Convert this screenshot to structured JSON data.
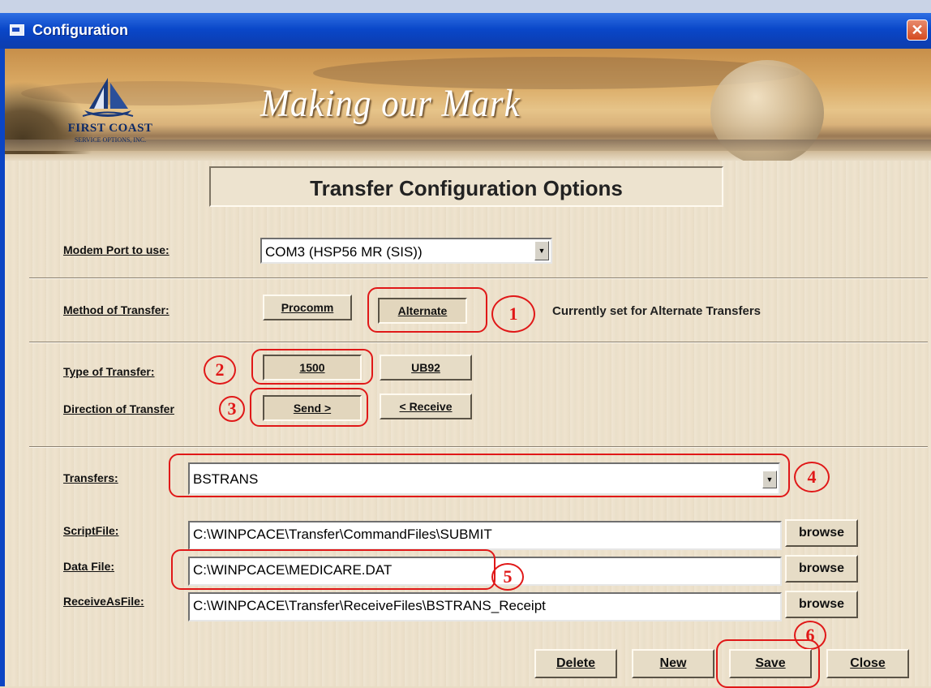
{
  "window": {
    "title": "Configuration",
    "close_glyph": "✕"
  },
  "banner": {
    "logo_name": "FIRST COAST",
    "logo_sub": "SERVICE OPTIONS, INC.",
    "tagline": "Making our Mark"
  },
  "heading": "Transfer Configuration Options",
  "modem": {
    "label": "Modem Port to use:",
    "value": "COM3 (HSP56 MR (SIS))"
  },
  "method": {
    "label": "Method of Transfer:",
    "procomm": "Procomm",
    "alternate": "Alternate",
    "status": "Currently set for Alternate Transfers"
  },
  "type": {
    "label": "Type of Transfer:",
    "opt1500": "1500",
    "optUB92": "UB92"
  },
  "direction": {
    "label": "Direction of Transfer",
    "send": "Send >",
    "receive": "< Receive"
  },
  "transfers": {
    "label": "Transfers:",
    "value": "BSTRANS"
  },
  "files": {
    "script_label": "ScriptFile:",
    "script_value": "C:\\WINPCACE\\Transfer\\CommandFiles\\SUBMIT",
    "data_label": "Data File:",
    "data_value": "C:\\WINPCACE\\MEDICARE.DAT",
    "receive_label": "ReceiveAsFile:",
    "receive_value": "C:\\WINPCACE\\Transfer\\ReceiveFiles\\BSTRANS_Receipt",
    "browse": "browse"
  },
  "actions": {
    "delete": "Delete",
    "new": "New",
    "save": "Save",
    "close": "Close"
  },
  "annotations": {
    "n1": "1",
    "n2": "2",
    "n3": "3",
    "n4": "4",
    "n5": "5",
    "n6": "6"
  },
  "colors": {
    "title_bar": "#0a47c9",
    "annotation": "#e01818",
    "dialog_bg": "#efe5d2"
  }
}
